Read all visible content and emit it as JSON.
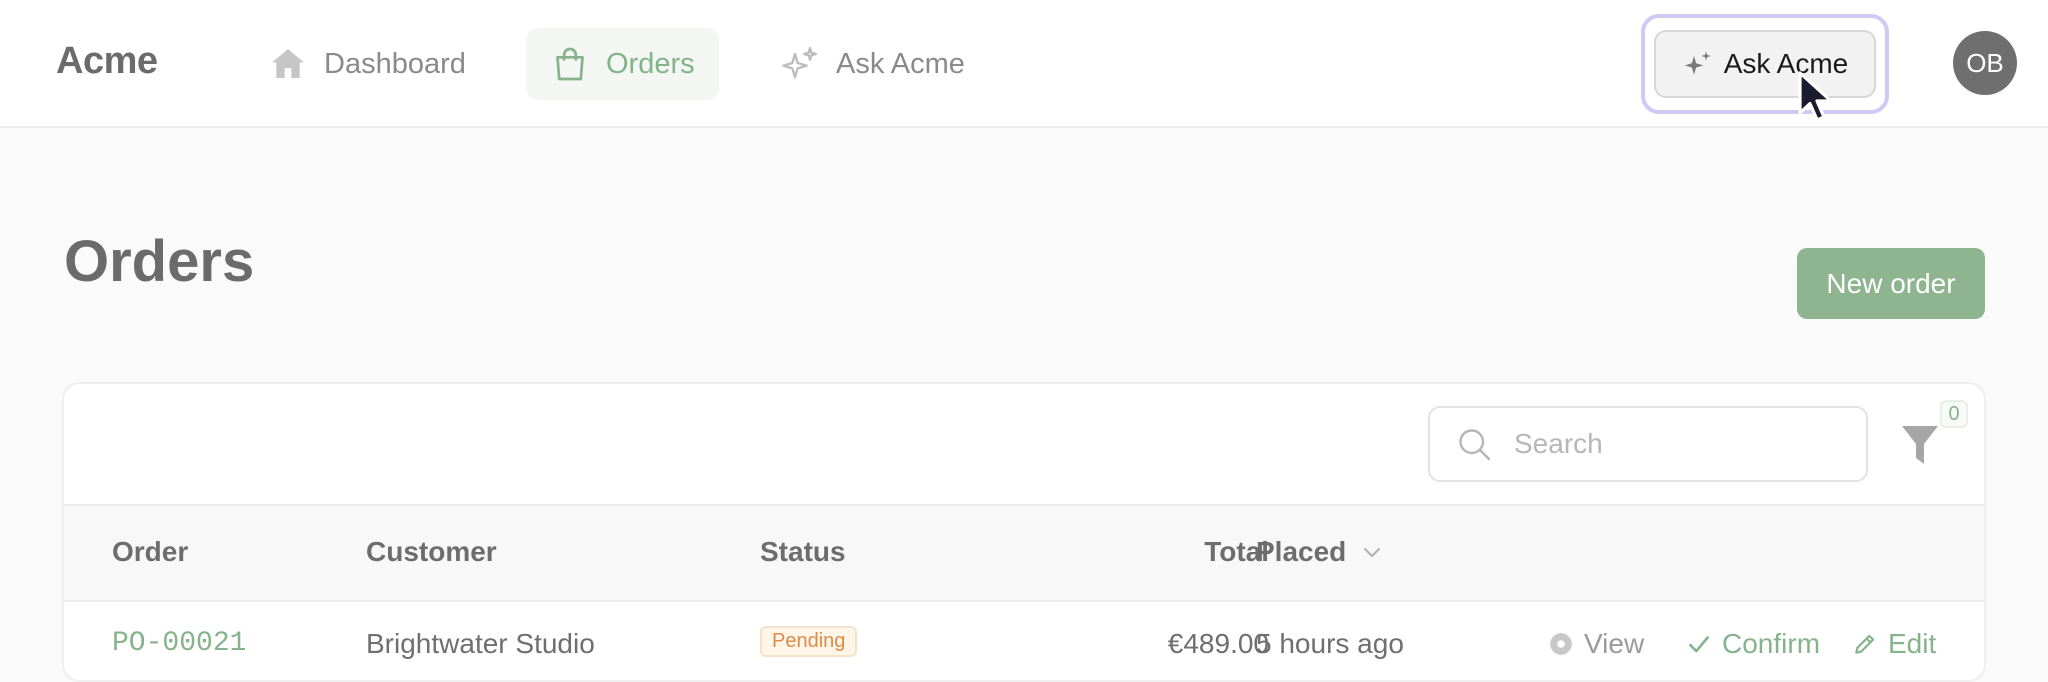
{
  "app": {
    "brand": "Acme"
  },
  "nav": {
    "items": [
      {
        "label": "Dashboard",
        "icon": "home-icon"
      },
      {
        "label": "Orders",
        "icon": "shopping-bag-icon",
        "active": true
      },
      {
        "label": "Ask Acme",
        "icon": "sparkles-icon"
      }
    ]
  },
  "header": {
    "ask_button_label": "Ask Acme",
    "avatar_initials": "OB"
  },
  "page": {
    "title": "Orders",
    "new_order_label": "New order"
  },
  "toolbar": {
    "search_placeholder": "Search",
    "filter_count": "0"
  },
  "table": {
    "columns": [
      "Order",
      "Customer",
      "Status",
      "Total",
      "Placed"
    ],
    "sort_column": "Placed",
    "rows": [
      {
        "order": "PO-00021",
        "customer": "Brightwater Studio",
        "status": "Pending",
        "total": "€489.00",
        "placed": "5 hours ago",
        "actions": [
          "View",
          "Confirm",
          "Edit"
        ]
      }
    ]
  },
  "colors": {
    "accent": "#86b38c",
    "primary_button": "#8fb590",
    "focus_ring": "#cfcaf3",
    "avatar": "#6f6f6f",
    "pending": "#e08b45"
  }
}
